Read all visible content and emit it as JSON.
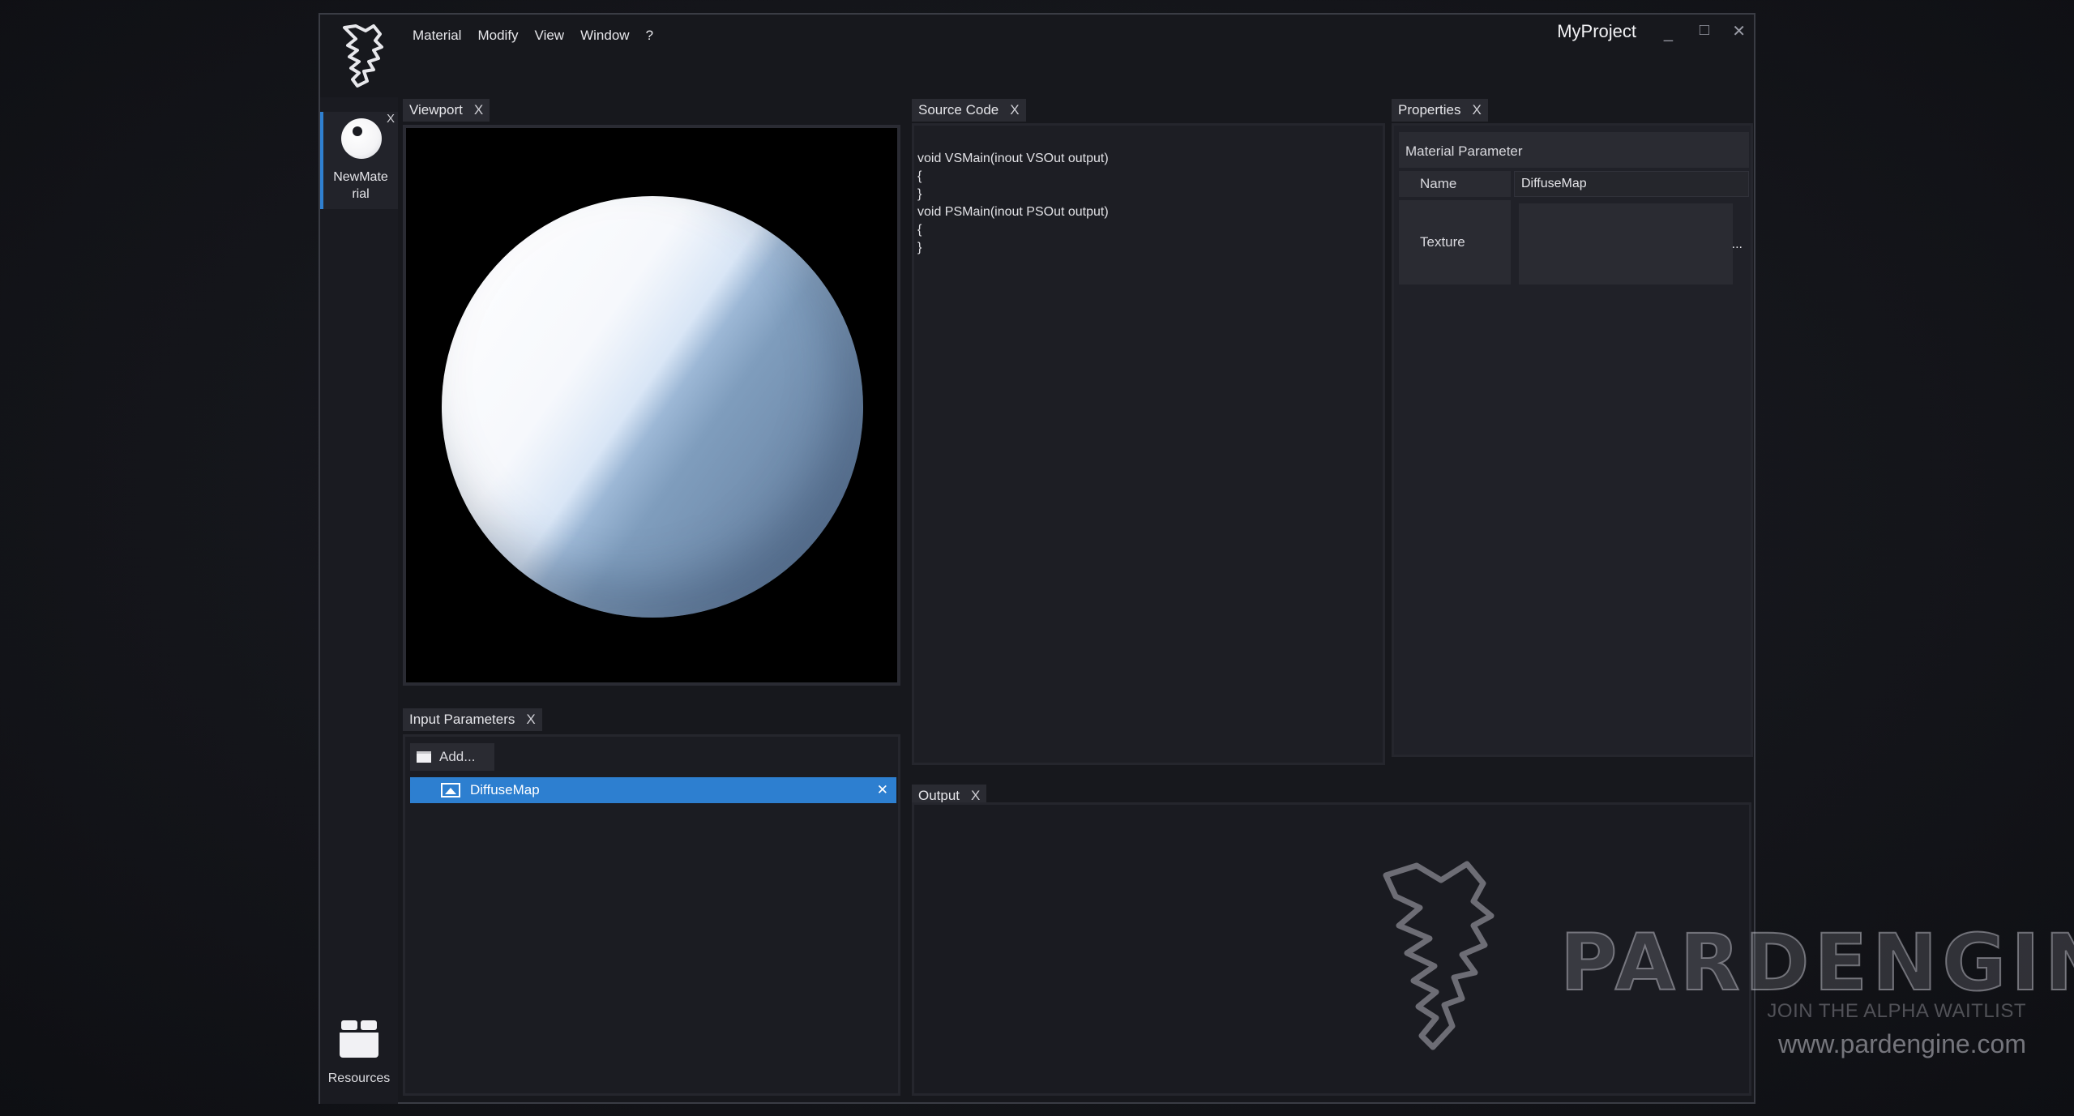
{
  "menu": [
    "Material",
    "Modify",
    "View",
    "Window",
    "?"
  ],
  "window": {
    "title": "MyProject",
    "minimize": "_",
    "maximize": "□",
    "close": "✕"
  },
  "left_dock": {
    "material_tab": {
      "label": "NewMate rial",
      "close": "X"
    },
    "resources_label": "Resources"
  },
  "viewport": {
    "tab_label": "Viewport",
    "close": "X"
  },
  "source_code": {
    "tab_label": "Source Code",
    "close": "X",
    "lines": [
      "void VSMain(inout VSOut output)",
      "{",
      "}",
      "void PSMain(inout PSOut output)",
      "{",
      "}"
    ]
  },
  "properties": {
    "tab_label": "Properties",
    "close": "X",
    "section": "Material Parameter",
    "name_label": "Name",
    "name_value": "DiffuseMap",
    "texture_label": "Texture",
    "texture_browse": "..."
  },
  "input_parameters": {
    "tab_label": "Input Parameters",
    "close": "X",
    "add_label": "Add...",
    "items": [
      {
        "name": "DiffuseMap",
        "close": "✕"
      }
    ]
  },
  "output": {
    "tab_label": "Output",
    "close": "X"
  },
  "watermark": {
    "brand": "PARDENGINE",
    "tagline": "JOIN THE ALPHA WAITLIST",
    "url": "www.pardengine.com"
  },
  "colors": {
    "accent": "#2d7fd0",
    "background": "#17181d",
    "panel": "#1d1e24"
  }
}
